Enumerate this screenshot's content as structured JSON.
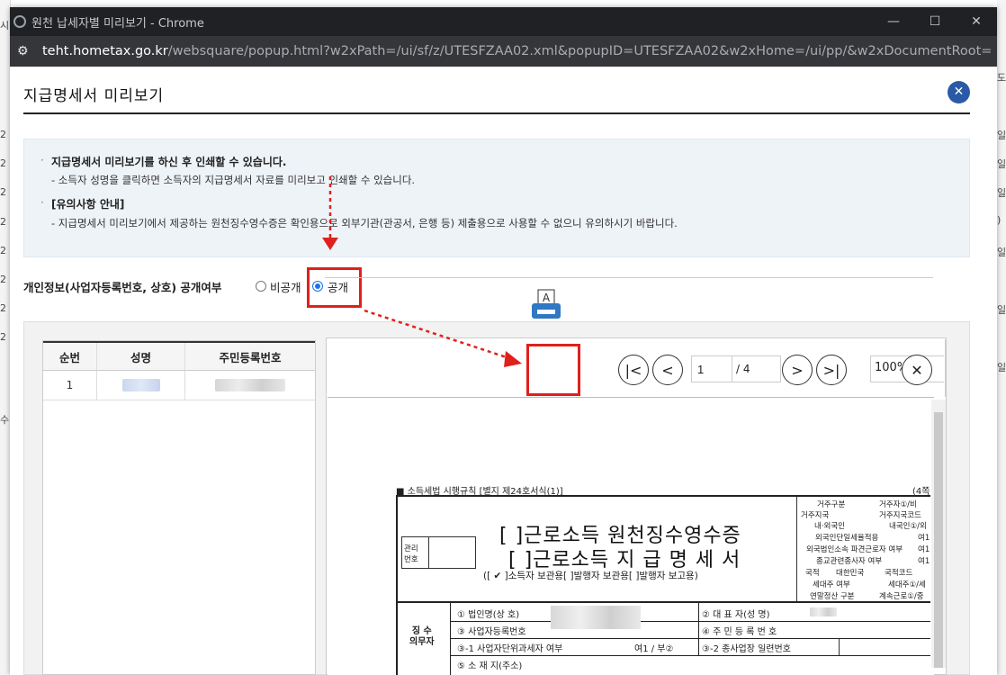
{
  "background_page": {
    "left_chars": [
      "시",
      "",
      "2",
      "2",
      "2",
      "2",
      "2",
      "2",
      "2",
      "2",
      "수"
    ],
    "right_chars": [
      "도",
      "일",
      "일",
      "일",
      ")",
      "일",
      "일",
      "일"
    ]
  },
  "window": {
    "title": "원천 납세자별 미리보기 - Chrome",
    "url_host": "teht.hometax.go.kr",
    "url_path": "/websquare/popup.html?w2xPath=/ui/sf/z/UTESFZAA02.xml&popupID=UTESFZAA02&w2xHome=/ui/pp/&w2xDocumentRoot=",
    "minimize_glyph": "—",
    "maximize_glyph": "☐",
    "close_glyph": "✕"
  },
  "popup": {
    "title": "지급명세서 미리보기",
    "close_glyph": "✕"
  },
  "info": {
    "line1": "지급명세서 미리보기를 하신 후 인쇄할 수 있습니다.",
    "line1_sub": "- 소득자 성명을 클릭하면 소득자의 지급명세서 자료를 미리보고 인쇄할 수 있습니다.",
    "line2": "[유의사항 안내]",
    "line2_sub": "- 지급명세서 미리보기에서 제공하는 원천징수영수증은 확인용으로 외부기관(관공서, 은행 등) 제출용으로 사용할 수 없으니 유의하시기 바랍니다.",
    "bullet": "·"
  },
  "privacy": {
    "label": "개인정보(사업자등록번호, 상호) 공개여부",
    "option_private": "비공개",
    "option_public": "공개",
    "selected": "공개"
  },
  "table": {
    "headers": [
      "순번",
      "성명",
      "주민등록번호"
    ],
    "rows": [
      {
        "no": "1"
      }
    ]
  },
  "viewer": {
    "page_current": "1",
    "page_total": "/ 4",
    "zoom": "100%",
    "first_glyph": "|<",
    "prev_glyph": "<",
    "next_glyph": ">",
    "last_glyph": ">|",
    "close_glyph": "✕"
  },
  "document": {
    "header_note": "■ 소득세법 시행규칙 [별지 제24호서식(1)]",
    "page_note": "(4쪽",
    "title1": "[  ]근로소득 원천징수영수증",
    "title2": "[  ]근로소득 지 급 명 세 서",
    "subtitle": "([ ✔ ]소득자 보관용[      ]발행자 보관용[      ]발행자 보고용)",
    "mgmt_no": "관리\n번호",
    "side_labels": [
      "거주구분",
      "거주자①/비",
      "거주지국",
      "거주지국코드",
      "내·외국인",
      "내국인①/외",
      "외국인단일세율적용",
      "여1",
      "외국법인소속 파견근로자 여부",
      "여1",
      "종교관련종사자 여부",
      "여1",
      "국적",
      "대한민국",
      "국적코드",
      "세대주 여부",
      "세대주①/세",
      "연말정산 구분",
      "계속근로①/중"
    ],
    "payer_label": "징 수\n의무자",
    "field1": "① 법인명(상  호)",
    "field2": "② 대 표 자(성  명)",
    "field3": "③ 사업자등록번호",
    "field4": "④ 주 민 등 록 번 호",
    "field5": "③-1 사업자단위과세자 여부",
    "field5_val": "여1 / 부②",
    "field6": "③-2 종사업장 일련번호",
    "field7": "⑤ 소 재 지(주소)"
  }
}
